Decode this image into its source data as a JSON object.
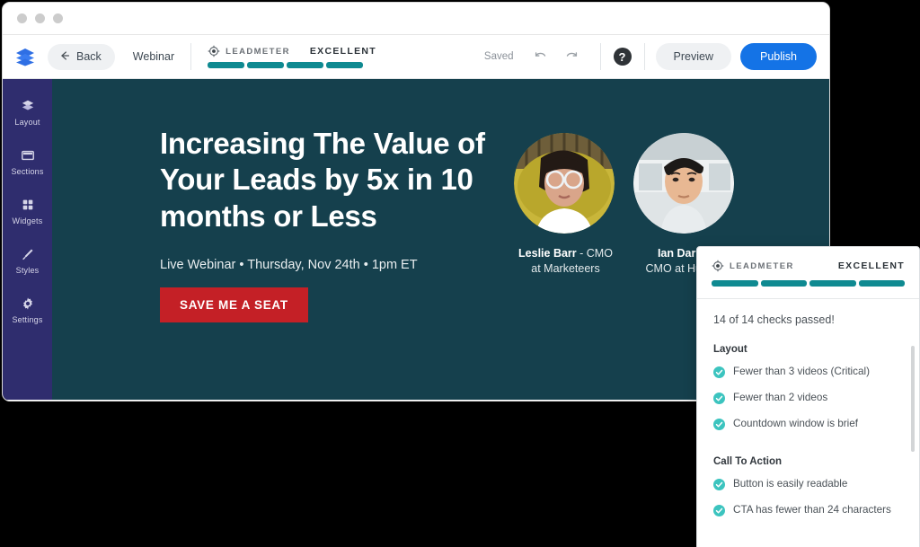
{
  "window": {
    "traffic_lights": [
      "close",
      "minimize",
      "maximize"
    ]
  },
  "toolbar": {
    "logo_icon": "layers-logo-icon",
    "back_label": "Back",
    "back_icon": "arrow-left-icon",
    "page_name": "Webinar",
    "leadmeter": {
      "target_icon": "target-icon",
      "name": "LEADMETER",
      "rating": "EXCELLENT",
      "segments": 4,
      "filled": 4,
      "color": "#0f8a91"
    },
    "saved_label": "Saved",
    "undo_icon": "undo-icon",
    "redo_icon": "redo-icon",
    "help_icon": "help-icon",
    "help_label": "?",
    "preview_label": "Preview",
    "publish_label": "Publish",
    "publish_color": "#1473e6"
  },
  "sidebar": {
    "background": "#2f2d6e",
    "items": [
      {
        "label": "Layout",
        "icon": "layers-icon"
      },
      {
        "label": "Sections",
        "icon": "sections-icon"
      },
      {
        "label": "Widgets",
        "icon": "widgets-grid-icon"
      },
      {
        "label": "Styles",
        "icon": "paintbrush-icon"
      },
      {
        "label": "Settings",
        "icon": "gear-icon"
      }
    ]
  },
  "canvas": {
    "background": "#15404d",
    "hero": {
      "headline": "Increasing  The Value of Your Leads by 5x in 10 months or Less",
      "subheading": "Live Webinar • Thursday, Nov 24th • 1pm ET",
      "cta_label": "SAVE ME A SEAT",
      "cta_color": "#c42026",
      "speakers": [
        {
          "avatar_icon": "speaker-avatar-photo",
          "name": "Leslie Barr",
          "role": " - CMO at Marketeers"
        },
        {
          "avatar_icon": "speaker-avatar-photo",
          "name": "Ian Darnol",
          "role": "CMO at Hu Puff"
        }
      ]
    }
  },
  "panel": {
    "leadmeter": {
      "target_icon": "target-icon",
      "name": "LEADMETER",
      "rating": "EXCELLENT",
      "segments": 4,
      "filled": 4,
      "color": "#0f8a91"
    },
    "summary": "14 of 14 checks passed!",
    "groups": [
      {
        "title": "Layout",
        "checks": [
          {
            "icon": "check-circle-icon",
            "label": "Fewer than 3 videos (Critical)",
            "passed": true
          },
          {
            "icon": "check-circle-icon",
            "label": "Fewer than 2 videos",
            "passed": true
          },
          {
            "icon": "check-circle-icon",
            "label": "Countdown window is brief",
            "passed": true
          }
        ]
      },
      {
        "title": "Call To Action",
        "checks": [
          {
            "icon": "check-circle-icon",
            "label": "Button is easily readable",
            "passed": true
          },
          {
            "icon": "check-circle-icon",
            "label": "CTA has fewer than 24 characters",
            "passed": true
          }
        ]
      }
    ],
    "check_color": "#3cc4bf",
    "scrollbar": "vertical-scrollbar"
  }
}
